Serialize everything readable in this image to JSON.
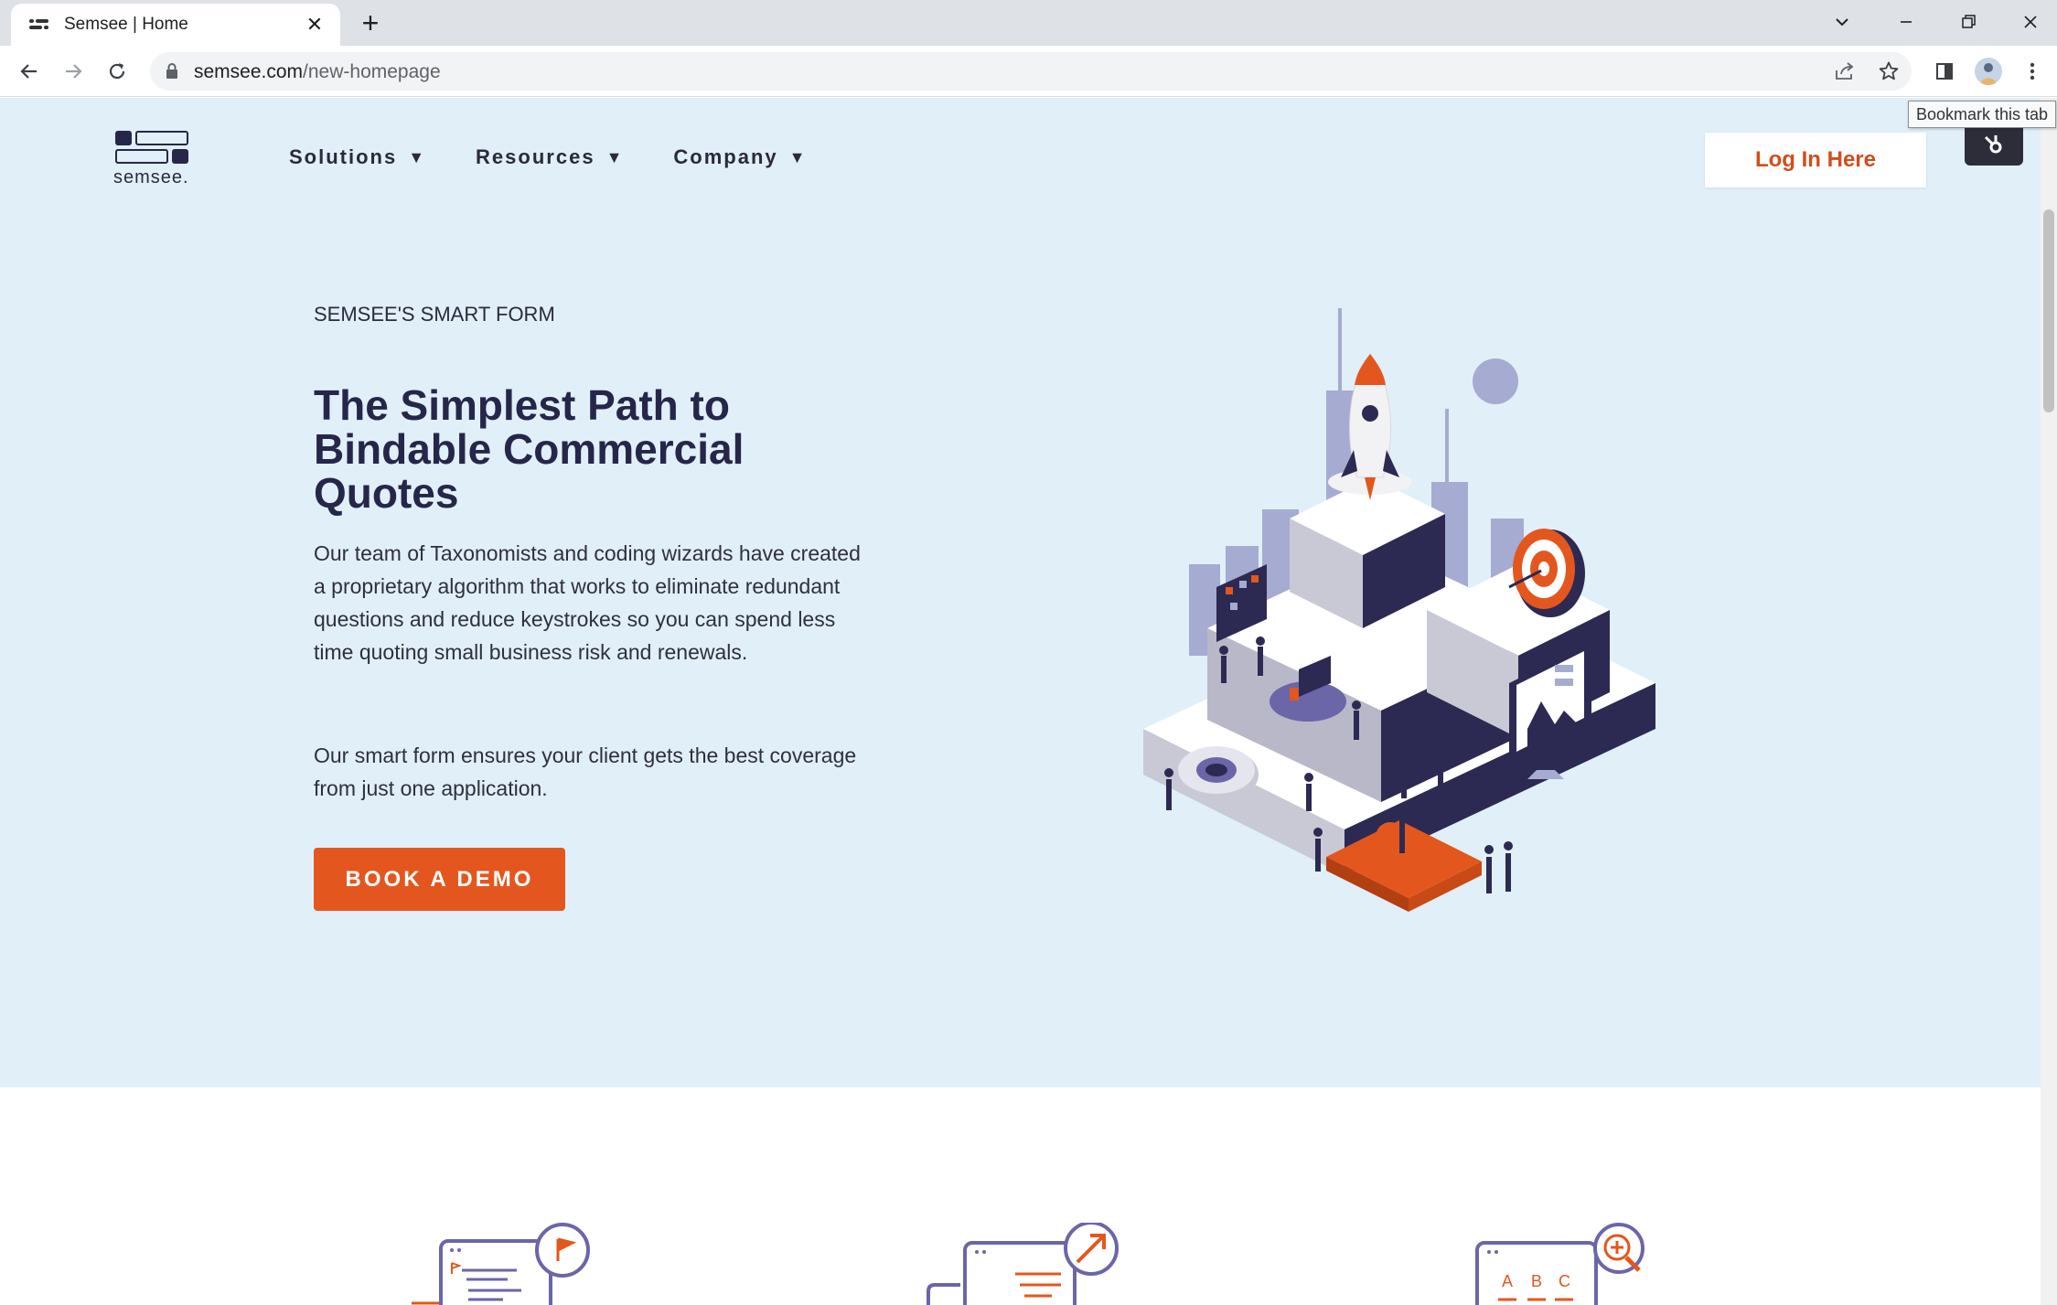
{
  "browser": {
    "tab_title": "Semsee | Home",
    "url_domain": "semsee.com",
    "url_path": "/new-homepage",
    "tooltip": "Bookmark this tab"
  },
  "header": {
    "logo_text": "semsee.",
    "nav": [
      {
        "label": "Solutions"
      },
      {
        "label": "Resources"
      },
      {
        "label": "Company"
      }
    ],
    "login_label": "Log In Here"
  },
  "hero": {
    "eyebrow": "SEMSEE'S SMART FORM",
    "headline_lines": [
      "The Simplest Path to",
      "Bindable Commercial",
      "Quotes"
    ],
    "paragraph1": "Our team of Taxonomists and coding wizards have created a proprietary algorithm that works to eliminate redundant questions and reduce keystrokes so you can spend less time quoting small business risk and renewals.",
    "paragraph2": "Our smart form ensures your client gets the best coverage from just one application.",
    "cta_label": "BOOK A DEMO"
  },
  "features": {
    "icon3_letters": [
      "A",
      "B",
      "C"
    ]
  },
  "colors": {
    "accent": "#e3571e",
    "navy": "#26264a",
    "hero_bg": "#e1eff8",
    "highlight": "#f5f33b"
  }
}
